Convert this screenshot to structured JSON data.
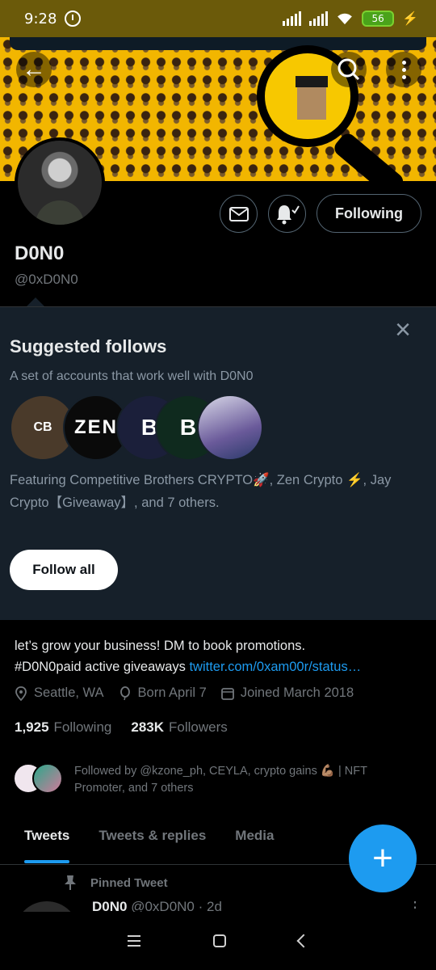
{
  "status_bar": {
    "time": "9:28",
    "battery": "56"
  },
  "profile": {
    "name": "D0N0",
    "handle": "@0xD0N0",
    "following_button": "Following"
  },
  "suggested": {
    "title": "Suggested follows",
    "subtitle": "A set of accounts that work well with D0N0",
    "avatars": [
      {
        "label": "CB"
      },
      {
        "label": "ZEN"
      },
      {
        "label": "B"
      },
      {
        "label": "B"
      },
      {
        "label": ""
      }
    ],
    "description": "Featuring Competitive Brothers CRYPTO🚀, Zen Crypto ⚡, Jay Crypto【Giveaway】, and 7 others.",
    "follow_all": "Follow all",
    "close": "×"
  },
  "bio": {
    "line1": "let’s grow your business! DM to book promotions.",
    "line2": "#D0N0paid active giveaways ",
    "link": "twitter.com/0xam00r/status…"
  },
  "meta": {
    "location": "Seattle, WA",
    "born": "Born April 7",
    "joined": "Joined March 2018"
  },
  "stats": {
    "following_count": "1,925",
    "following_label": "Following",
    "followers_count": "283K",
    "followers_label": "Followers"
  },
  "followed_by": "Followed by @kzone_ph, CEYLA, crypto gains 💪🏽 | NFT Promoter, and 7 others",
  "tabs": [
    {
      "label": "Tweets"
    },
    {
      "label": "Tweets & replies"
    },
    {
      "label": "Media"
    }
  ],
  "fab_label": "+",
  "pinned": {
    "label": "Pinned Tweet",
    "name": "D0N0",
    "handle": "@0xD0N0 · 2d"
  },
  "colors": {
    "accent": "#1d9bf0",
    "banner": "#f2b600",
    "panel": "#16202a"
  }
}
